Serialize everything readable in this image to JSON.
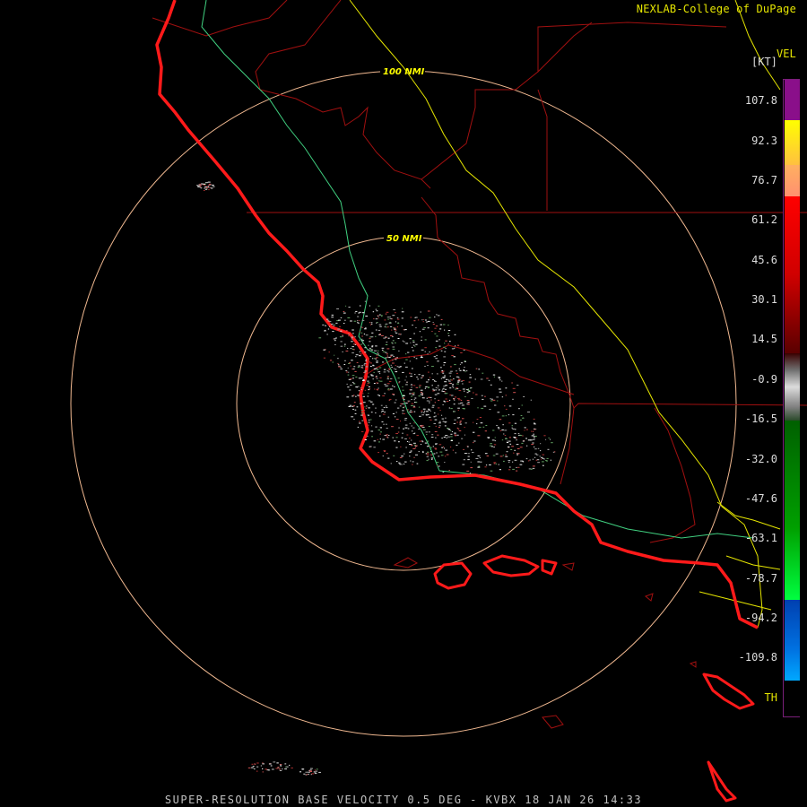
{
  "credit": "NEXLAB-College of DuPage",
  "legend": {
    "product": "VEL",
    "unit": "[KT]",
    "labels": [
      "107.8",
      "92.3",
      "76.7",
      "61.2",
      "45.6",
      "30.1",
      "14.5",
      "-0.9",
      "-16.5",
      "-32.0",
      "-47.6",
      "-63.1",
      "-78.7",
      "-94.2",
      "-109.8",
      "TH"
    ],
    "colors": {
      "purple": "#8a0f8a",
      "yellow": "#ffff00",
      "orange": "#ffa070",
      "red": "#ff0000",
      "dark_red": "#5a0000",
      "gray": "#c8c8c8",
      "green": "#008a00",
      "bright_green": "#00ff40",
      "blue": "#0050c8",
      "cyan": "#00a0ff"
    }
  },
  "rings": {
    "inner_label": "50 NMI",
    "outer_label": "100 NMI"
  },
  "footer": "SUPER-RESOLUTION BASE VELOCITY 0.5 DEG - KVBX 18 JAN 26 14:33",
  "map_colors": {
    "coast": "#ff1a1a",
    "county": "#a01010",
    "highway_green": "#40d080",
    "highway_yellow": "#e5e500",
    "ring": "#f0b890"
  }
}
